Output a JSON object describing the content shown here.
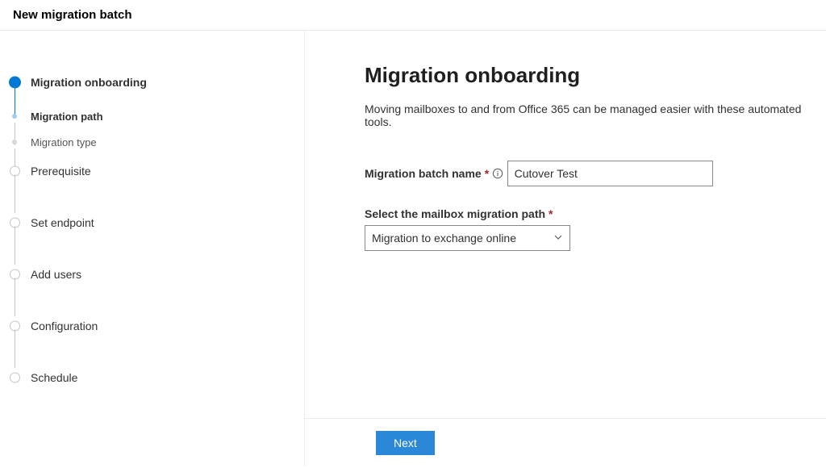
{
  "header": {
    "title": "New migration batch"
  },
  "sidebar": {
    "steps": [
      {
        "label": "Migration onboarding",
        "kind": "active"
      },
      {
        "label": "Migration path",
        "kind": "sub"
      },
      {
        "label": "Migration type",
        "kind": "sub2"
      },
      {
        "label": "Prerequisite",
        "kind": "normal"
      },
      {
        "label": "Set endpoint",
        "kind": "normal"
      },
      {
        "label": "Add users",
        "kind": "normal"
      },
      {
        "label": "Configuration",
        "kind": "normal"
      },
      {
        "label": "Schedule",
        "kind": "normal"
      }
    ]
  },
  "main": {
    "heading": "Migration onboarding",
    "description": "Moving mailboxes to and from Office 365 can be managed easier with these automated tools.",
    "batch_name_label": "Migration batch name",
    "batch_name_value": "Cutover Test",
    "path_label": "Select the mailbox migration path",
    "path_value": "Migration to exchange online"
  },
  "footer": {
    "next_label": "Next"
  },
  "colors": {
    "primary": "#0078d4",
    "required": "#a4262c"
  }
}
